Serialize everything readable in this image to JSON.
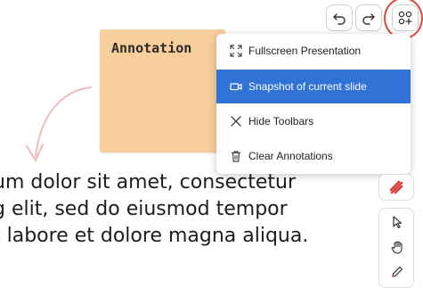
{
  "note": {
    "title": "Annotation"
  },
  "slide": {
    "lines": [
      "um dolor sit amet, consectetur",
      "g elit, sed do eiusmod tempor",
      "t labore et dolore magna aliqua."
    ]
  },
  "toolbar": {
    "undo_icon": "undo-icon",
    "redo_icon": "redo-icon",
    "more_icon": "shapes-plus-icon"
  },
  "menu": {
    "items": [
      {
        "label": "Fullscreen Presentation",
        "icon": "fullscreen-icon"
      },
      {
        "label": "Snapshot of current slide",
        "icon": "camera-icon",
        "active": true
      },
      {
        "label": "Hide Toolbars",
        "icon": "close-icon"
      },
      {
        "label": "Clear Annotations",
        "icon": "trash-icon"
      }
    ]
  },
  "colors": {
    "accent": "#3172d6",
    "note": "#f7cf9c",
    "highlight_ring": "#e1463a",
    "pen": "#d93a3a"
  }
}
